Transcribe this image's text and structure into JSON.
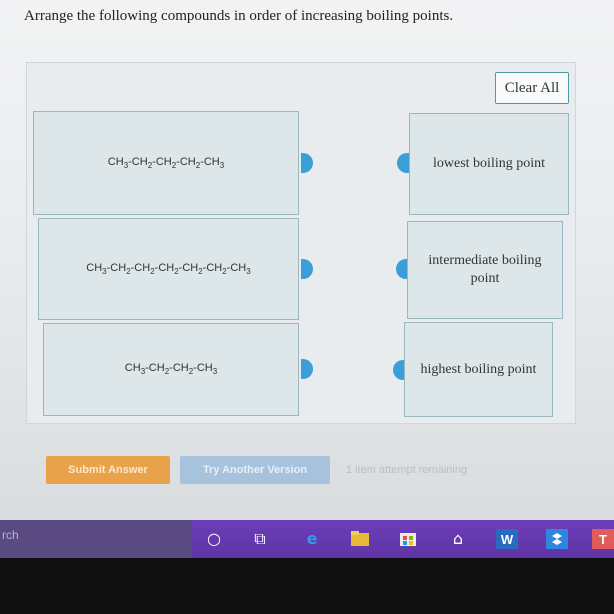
{
  "question": "Arrange the following compounds in order of increasing boiling points.",
  "clear_all": "Clear All",
  "compounds": [
    {
      "parts": [
        "CH",
        "3",
        "-CH",
        "2",
        "-CH",
        "2",
        "-CH",
        "2",
        "-CH",
        "3"
      ]
    },
    {
      "parts": [
        "CH",
        "3",
        "-CH",
        "2",
        "-CH",
        "2",
        "-CH",
        "2",
        "-CH",
        "2",
        "-CH",
        "2",
        "-CH",
        "3"
      ]
    },
    {
      "parts": [
        "CH",
        "3",
        "-CH",
        "2",
        "-CH",
        "2",
        "-CH",
        "3"
      ]
    }
  ],
  "targets": [
    {
      "label": "lowest boiling point"
    },
    {
      "label": "intermediate boiling point"
    },
    {
      "label": "highest boiling point"
    }
  ],
  "buttons": {
    "submit": "Submit Answer",
    "try_another": "Try Another Version"
  },
  "attempts_text": "1 item attempt remaining",
  "taskbar": {
    "search_text": "rch"
  }
}
